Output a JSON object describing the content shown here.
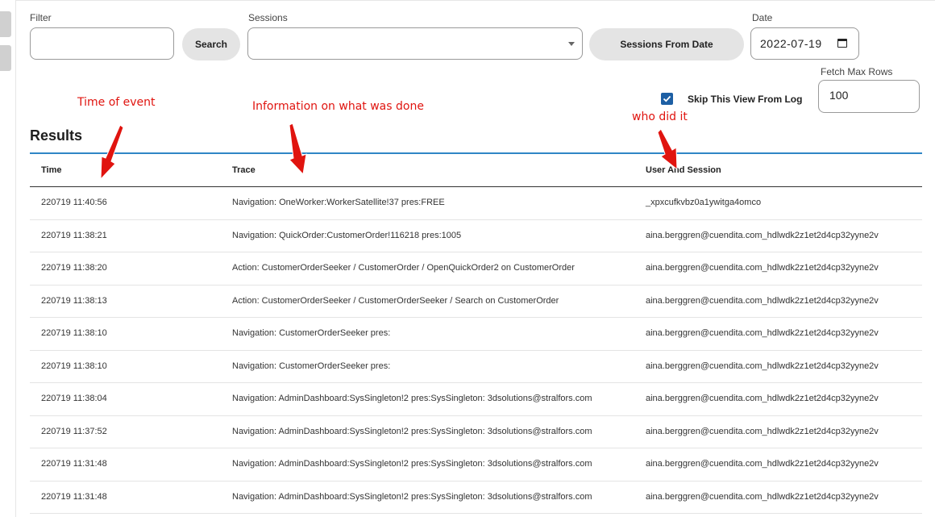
{
  "filters": {
    "filter_label": "Filter",
    "filter_value": "",
    "search_label": "Search",
    "sessions_label": "Sessions",
    "sessions_value": "",
    "sessions_from_date_label": "Sessions From Date",
    "date_label": "Date",
    "date_value": "2022-07-19",
    "fetch_max_label": "Fetch Max Rows",
    "fetch_max_value": "100",
    "skip_label": "Skip This View From Log",
    "skip_checked": true
  },
  "results": {
    "title": "Results",
    "columns": [
      "Time",
      "Trace",
      "User And Session"
    ],
    "rows": [
      [
        "220719 11:40:56",
        "Navigation: OneWorker:WorkerSatellite!37 pres:FREE",
        "_xpxcufkvbz0a1ywitga4omco"
      ],
      [
        "220719 11:38:21",
        "Navigation: QuickOrder:CustomerOrder!116218 pres:1005",
        "aina.berggren@cuendita.com_hdlwdk2z1et2d4cp32yyne2v"
      ],
      [
        "220719 11:38:20",
        "Action: CustomerOrderSeeker / CustomerOrder / OpenQuickOrder2 on CustomerOrder",
        "aina.berggren@cuendita.com_hdlwdk2z1et2d4cp32yyne2v"
      ],
      [
        "220719 11:38:13",
        "Action: CustomerOrderSeeker / CustomerOrderSeeker / Search on CustomerOrder",
        "aina.berggren@cuendita.com_hdlwdk2z1et2d4cp32yyne2v"
      ],
      [
        "220719 11:38:10",
        "Navigation: CustomerOrderSeeker pres:",
        "aina.berggren@cuendita.com_hdlwdk2z1et2d4cp32yyne2v"
      ],
      [
        "220719 11:38:10",
        "Navigation: CustomerOrderSeeker pres:",
        "aina.berggren@cuendita.com_hdlwdk2z1et2d4cp32yyne2v"
      ],
      [
        "220719 11:38:04",
        "Navigation: AdminDashboard:SysSingleton!2 pres:SysSingleton: 3dsolutions@stralfors.com",
        "aina.berggren@cuendita.com_hdlwdk2z1et2d4cp32yyne2v"
      ],
      [
        "220719 11:37:52",
        "Navigation: AdminDashboard:SysSingleton!2 pres:SysSingleton: 3dsolutions@stralfors.com",
        "aina.berggren@cuendita.com_hdlwdk2z1et2d4cp32yyne2v"
      ],
      [
        "220719 11:31:48",
        "Navigation: AdminDashboard:SysSingleton!2 pres:SysSingleton: 3dsolutions@stralfors.com",
        "aina.berggren@cuendita.com_hdlwdk2z1et2d4cp32yyne2v"
      ],
      [
        "220719 11:31:48",
        "Navigation: AdminDashboard:SysSingleton!2 pres:SysSingleton: 3dsolutions@stralfors.com",
        "aina.berggren@cuendita.com_hdlwdk2z1et2d4cp32yyne2v"
      ]
    ]
  },
  "annotations": {
    "time": "Time of event",
    "info": "Information on what was done",
    "who": "who did it",
    "color": "#e0140f"
  },
  "colors": {
    "accent": "#2f86c6",
    "checkbox": "#1d5fa4",
    "pill_bg": "#e4e4e4"
  },
  "icons": {
    "date_picker": "calendar-icon",
    "sessions_dropdown": "chevron-down-icon",
    "checkbox": "checkmark-icon"
  }
}
